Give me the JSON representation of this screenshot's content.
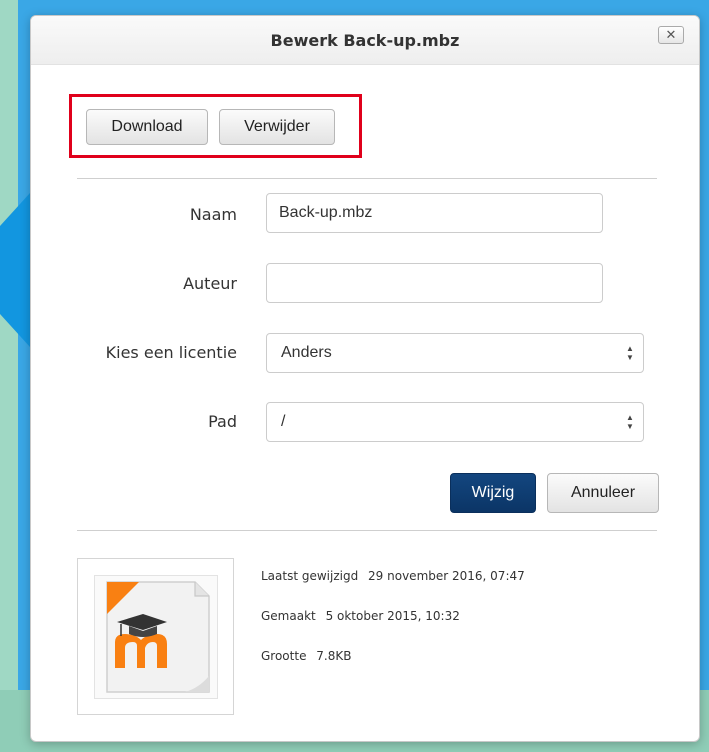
{
  "dialog": {
    "title": "Bewerk Back-up.mbz",
    "close_icon_glyph": "✕"
  },
  "actions": {
    "download_label": "Download",
    "delete_label": "Verwijder"
  },
  "form": {
    "name": {
      "label": "Naam",
      "value": "Back-up.mbz"
    },
    "author": {
      "label": "Auteur",
      "value": ""
    },
    "license": {
      "label": "Kies een licentie",
      "selected": "Anders"
    },
    "path": {
      "label": "Pad",
      "selected": "/"
    },
    "save_label": "Wijzig",
    "cancel_label": "Annuleer"
  },
  "file_info": {
    "modified_label": "Laatst gewijzigd",
    "modified_value": "29 november 2016, 07:47",
    "created_label": "Gemaakt",
    "created_value": "5 oktober 2015, 10:32",
    "size_label": "Grootte",
    "size_value": "7.8KB",
    "thumbnail_icon": "moodle-file-icon"
  },
  "colors": {
    "primary_button": "#0b3566",
    "highlight": "#e0001b",
    "moodle_orange": "#f98012"
  }
}
